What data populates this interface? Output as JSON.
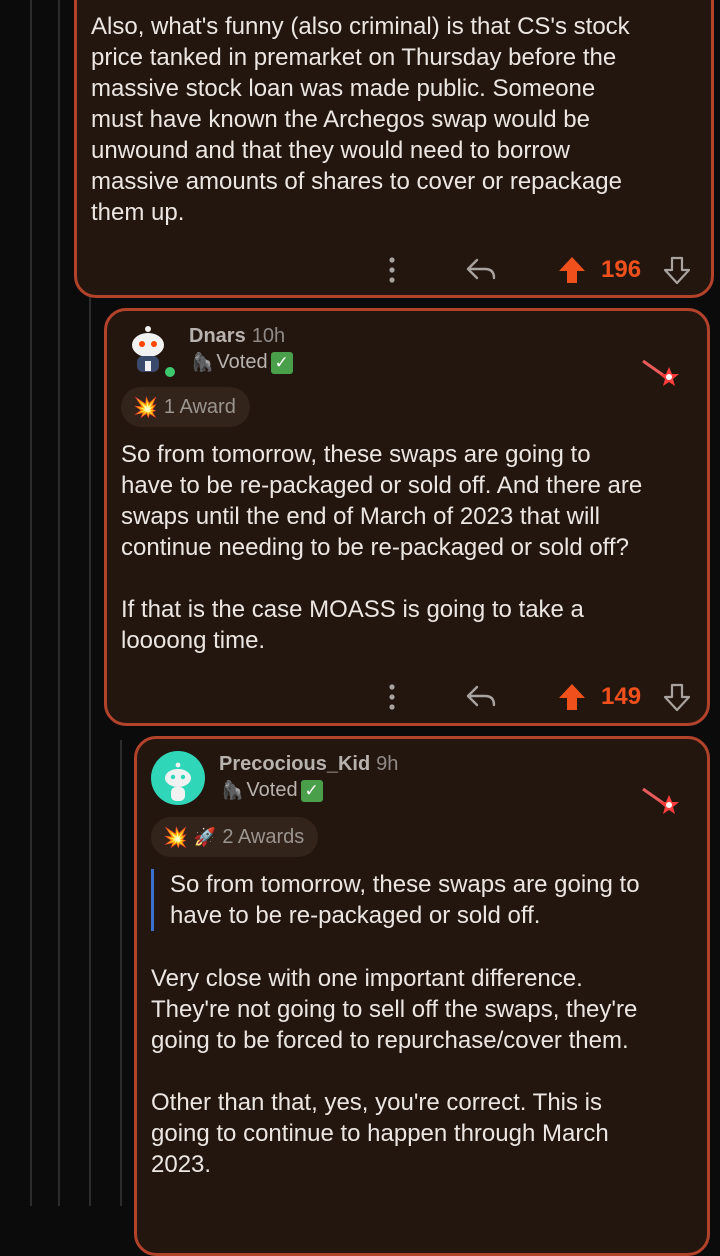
{
  "comments": [
    {
      "body": [
        "Also, what's funny (also criminal) is that CS's stock\nprice tanked in premarket on Thursday before the\nmassive stock loan was made public. Someone\nmust have known the Archegos swap would be\nunwound and that they would need to borrow\nmassive amounts of shares to cover or repackage\nthem up."
      ],
      "score": "196"
    },
    {
      "username": "Dnars",
      "age": "10h",
      "flair": "Voted",
      "awards_label": "1 Award",
      "body": [
        "So from tomorrow, these swaps are going to\nhave to be re-packaged or sold off. And there are\nswaps until the end of March of 2023 that will\ncontinue needing to be re-packaged or sold off?",
        "If that is the case MOASS is going to take a\nloooong time."
      ],
      "score": "149"
    },
    {
      "username": "Precocious_Kid",
      "age": "9h",
      "flair": "Voted",
      "awards_label": "2 Awards",
      "quote": "So from tomorrow, these swaps are going to\nhave to be re-packaged or sold off.",
      "body": [
        "Very close with one important difference.\nThey're not going to sell off the swaps, they're\ngoing to be forced to repurchase/cover them.",
        "Other than that, yes, you're correct. This is\ngoing to continue to happen through March\n2023."
      ]
    }
  ],
  "colors": {
    "accent": "#f0501c",
    "card_border": "#b2432a",
    "card_bg": "#23160f",
    "voted_check": "#4aa04a"
  },
  "icons": [
    "more-vertical-icon",
    "reply-icon",
    "upvote-icon",
    "downvote-icon",
    "award-icon",
    "gorilla-flair-icon",
    "checkmark-icon",
    "rocket-award-icon",
    "snoo-avatar-icon"
  ]
}
